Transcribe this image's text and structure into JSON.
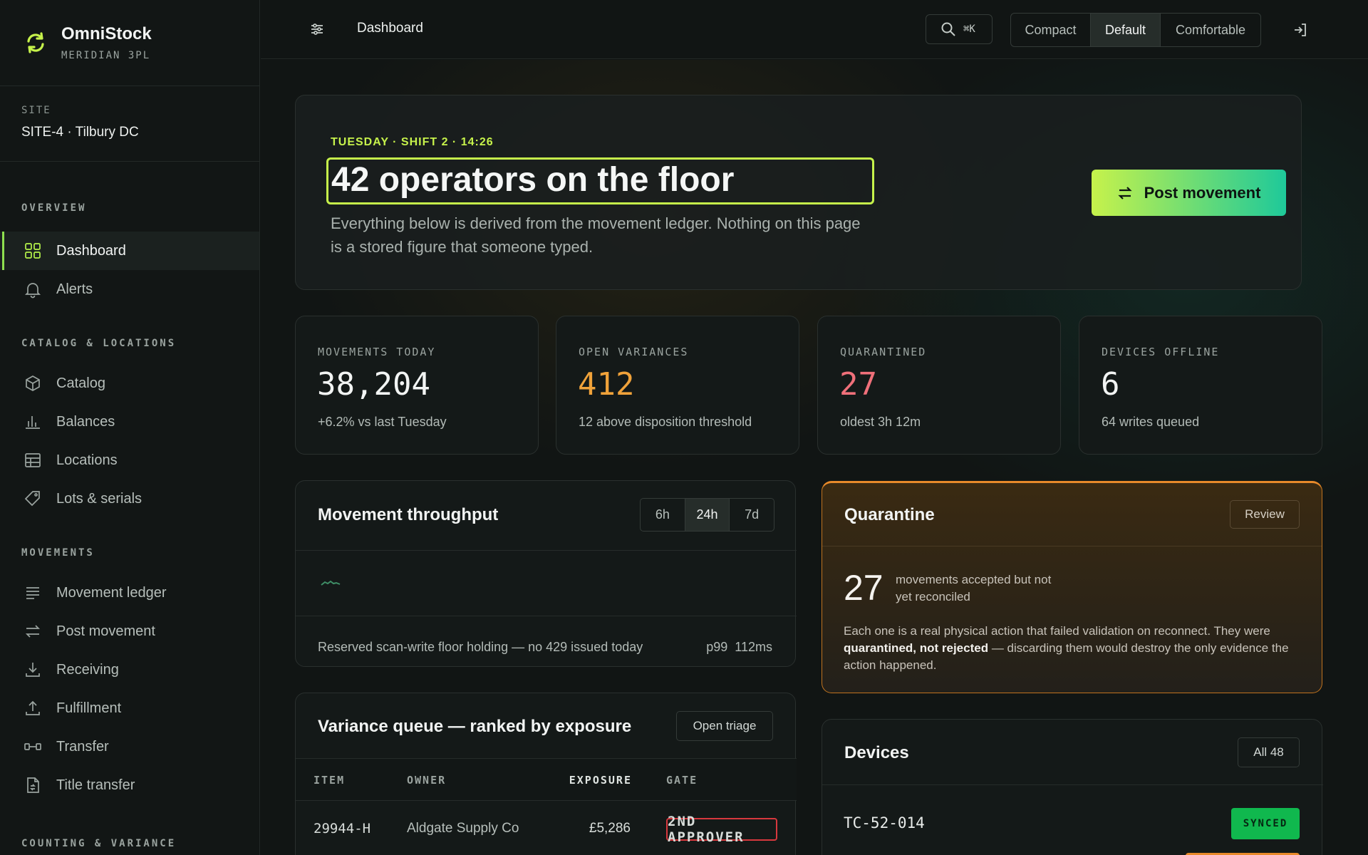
{
  "brand": {
    "name": "OmniStock",
    "sub": "MERIDIAN 3PL"
  },
  "site": {
    "label": "SITE",
    "value": "SITE-4 · Tilbury DC"
  },
  "nav": {
    "overview_title": "OVERVIEW",
    "overview": [
      {
        "label": "Dashboard",
        "icon": "grid-icon",
        "active": true
      },
      {
        "label": "Alerts",
        "icon": "bell-icon"
      }
    ],
    "catalog_title": "CATALOG & LOCATIONS",
    "catalog": [
      {
        "label": "Catalog",
        "icon": "box-icon"
      },
      {
        "label": "Balances",
        "icon": "bar-chart-icon"
      },
      {
        "label": "Locations",
        "icon": "table-icon"
      },
      {
        "label": "Lots & serials",
        "icon": "tag-icon"
      }
    ],
    "movements_title": "MOVEMENTS",
    "movements": [
      {
        "label": "Movement ledger",
        "icon": "list-icon"
      },
      {
        "label": "Post movement",
        "icon": "swap-icon"
      },
      {
        "label": "Receiving",
        "icon": "download-icon"
      },
      {
        "label": "Fulfillment",
        "icon": "upload-icon"
      },
      {
        "label": "Transfer",
        "icon": "transfer-icon"
      },
      {
        "label": "Title transfer",
        "icon": "document-icon"
      }
    ],
    "counting_title": "COUNTING & VARIANCE"
  },
  "topbar": {
    "title": "Dashboard",
    "search_shortcut": "⌘K",
    "density": [
      "Compact",
      "Default",
      "Comfortable"
    ],
    "density_selected": "Default"
  },
  "hero": {
    "eyebrow": "TUESDAY · SHIFT 2 · 14:26",
    "title": "42 operators on the floor",
    "desc": "Everything below is derived from the movement ledger. Nothing on this page is a stored figure that someone typed.",
    "button": "Post movement"
  },
  "stats": [
    {
      "label": "MOVEMENTS TODAY",
      "value": "38,204",
      "note": "+6.2% vs last Tuesday",
      "color": "#f2f4f3"
    },
    {
      "label": "OPEN VARIANCES",
      "value": "412",
      "note": "12 above disposition threshold",
      "color": "#f0a23a"
    },
    {
      "label": "QUARANTINED",
      "value": "27",
      "note": "oldest 3h 12m",
      "color": "#f0707a"
    },
    {
      "label": "DEVICES OFFLINE",
      "value": "6",
      "note": "64 writes queued",
      "color": "#f2f4f3"
    }
  ],
  "throughput": {
    "title": "Movement throughput",
    "ranges": [
      "6h",
      "24h",
      "7d"
    ],
    "range_selected": "24h",
    "footer": "Reserved scan-write floor holding — no 429 issued today",
    "p99_label": "p99",
    "p99_value": "112ms"
  },
  "quarantine": {
    "title": "Quarantine",
    "button": "Review",
    "count": "27",
    "count_text": "movements accepted but not yet reconciled",
    "body_pre": "Each one is a real physical action that failed validation on reconnect. They were ",
    "body_bold": "quarantined, not rejected",
    "body_post": " — discarding them would destroy the only evidence the action happened."
  },
  "variance": {
    "title": "Variance queue — ranked by exposure",
    "button": "Open triage",
    "columns": [
      "ITEM",
      "OWNER",
      "EXPOSURE",
      "GATE"
    ],
    "rows": [
      {
        "item": "29944-H",
        "owner": "Aldgate Supply Co",
        "exposure": "£5,286",
        "gate": "2ND APPROVER"
      }
    ]
  },
  "devices": {
    "title": "Devices",
    "button": "All 48",
    "rows": [
      {
        "id": "TC-52-014",
        "status": "SYNCED"
      }
    ]
  }
}
